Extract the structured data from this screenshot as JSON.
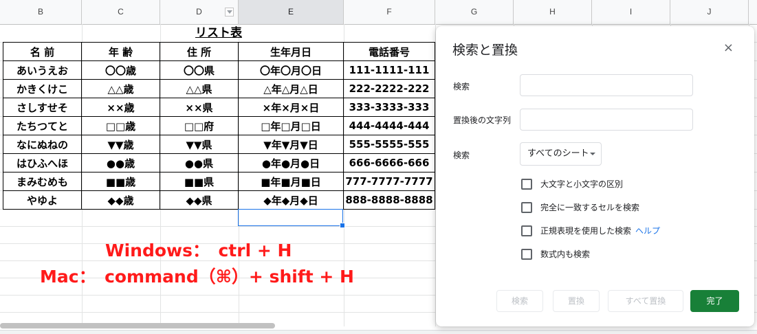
{
  "columns": [
    "B",
    "C",
    "D",
    "E",
    "F",
    "G",
    "H",
    "I",
    "J"
  ],
  "sheet": {
    "title": "リスト表",
    "headers": [
      "名 前",
      "年 齢",
      "住 所",
      "生年月日",
      "電話番号"
    ],
    "rows": [
      [
        "あいうえお",
        "〇〇歳",
        "〇〇県",
        "〇年〇月〇日",
        "111-1111-111"
      ],
      [
        "かきくけこ",
        "△△歳",
        "△△県",
        "△年△月△日",
        "222-2222-222"
      ],
      [
        "さしすせそ",
        "××歳",
        "××県",
        "×年×月×日",
        "333-3333-333"
      ],
      [
        "たちつてと",
        "□□歳",
        "□□府",
        "□年□月□日",
        "444-4444-444"
      ],
      [
        "なにぬねの",
        "▼▼歳",
        "▼▼県",
        "▼年▼月▼日",
        "555-5555-555"
      ],
      [
        "はひふへほ",
        "●●歳",
        "●●県",
        "●年●月●日",
        "666-6666-666"
      ],
      [
        "まみむめも",
        "■■歳",
        "■■県",
        "■年■月■日",
        "777-7777-7777"
      ],
      [
        "やゆよ",
        "◆◆歳",
        "◆◆県",
        "◆年◆月◆日",
        "888-8888-8888"
      ]
    ]
  },
  "notes": {
    "windows": "Windows：　ctrl + H",
    "mac": "Mac：　command（⌘）+ shift + H",
    "color": "#ff1a1a"
  },
  "dialog": {
    "title": "検索と置換",
    "close_icon": "×",
    "find_label": "検索",
    "find_value": "",
    "replace_label": "置換後の文字列",
    "replace_value": "",
    "scope_label": "検索",
    "scope_value": "すべてのシート",
    "options": {
      "match_case": "大文字と小文字の区別",
      "entire_cell": "完全に一致するセルを検索",
      "regex": "正規表現を使用した検索",
      "help": "ヘルプ",
      "formulas": "数式内も検索"
    },
    "buttons": {
      "find": "検索",
      "replace": "置換",
      "replace_all": "すべて置換",
      "done": "完了"
    },
    "accent_color": "#188038",
    "link_color": "#1a73e8"
  }
}
